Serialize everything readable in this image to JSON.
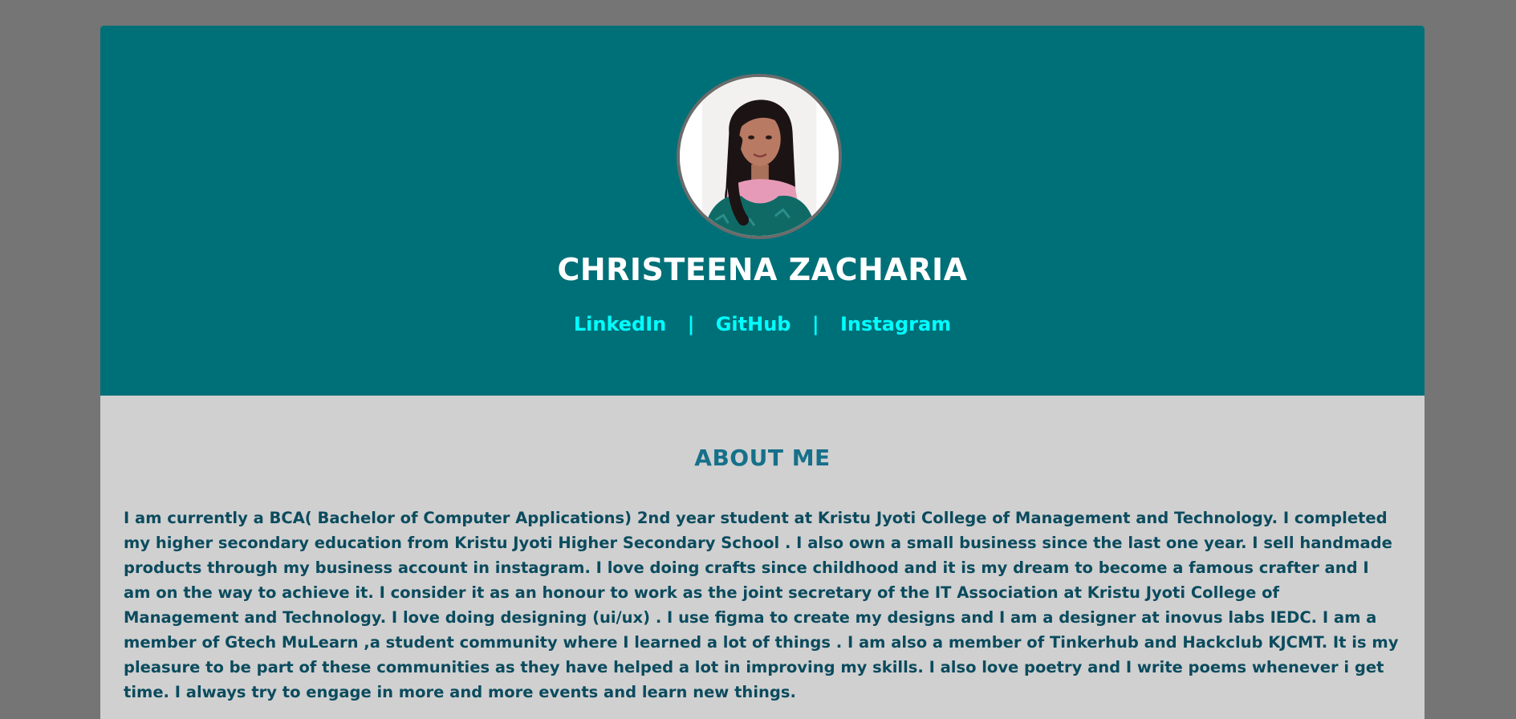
{
  "colors": {
    "page_background": "#757575",
    "hero_background": "#007078",
    "content_background": "#d0d0d0",
    "name_color": "#ffffff",
    "link_color": "#00ffff",
    "heading_color": "#16708a",
    "body_text_color": "#0b4b5e"
  },
  "profile": {
    "name": "CHRISTEENA ZACHARIA",
    "avatar_alt": "profile photo"
  },
  "social_links": [
    {
      "label": "LinkedIn"
    },
    {
      "label": "GitHub"
    },
    {
      "label": "Instagram"
    }
  ],
  "separator": "|",
  "about": {
    "title": "ABOUT ME",
    "text": "I am currently a BCA( Bachelor of Computer Applications) 2nd year student at Kristu Jyoti College of Management and Technology. I completed my higher secondary education from Kristu Jyoti Higher Secondary School . I also own a small business since the last one year. I sell handmade products through my business account in instagram. I love doing crafts since childhood and it is my dream to become a famous crafter and I am on the way to achieve it. I consider it as an honour to work as the joint secretary of the IT Association at Kristu Jyoti College of Management and Technology. I love doing designing (ui/ux) . I use figma to create my designs and I am a designer at inovus labs IEDC. I am a member of Gtech MuLearn ,a student community where I learned a lot of things . I am also a member of Tinkerhub and Hackclub KJCMT. It is my pleasure to be part of these communities as they have helped a lot in improving my skills. I also love poetry and I write poems whenever i get time. I always try to engage in more and more events and learn new things."
  }
}
